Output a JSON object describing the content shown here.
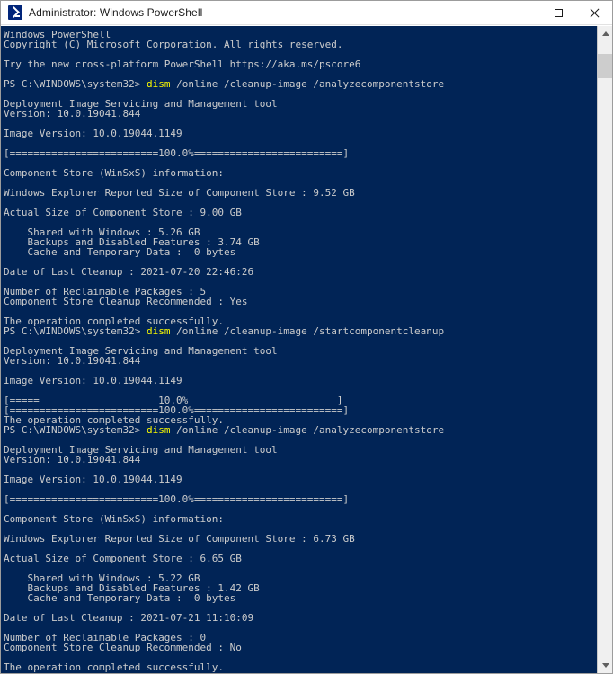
{
  "window": {
    "title": "Administrator: Windows PowerShell",
    "icon": "powershell-icon",
    "colors": {
      "console_background": "#012456",
      "console_text": "#cccccc",
      "command_highlight": "#f9f900",
      "titlebar_background": "#ffffff",
      "titlebar_text": "#1b1b1b",
      "scrollbar_track": "#f0f0f0",
      "scrollbar_thumb": "#cdcdcd"
    },
    "controls": [
      {
        "name": "minimize-button",
        "label": "─"
      },
      {
        "name": "maximize-button",
        "label": "□"
      },
      {
        "name": "close-button",
        "label": "✕"
      }
    ]
  },
  "scrollbar": {
    "up_arrow": "scroll-up-arrow",
    "down_arrow": "scroll-down-arrow",
    "thumb_top_percent": 2,
    "thumb_height_percent": 4
  },
  "console": {
    "prompt": "PS C:\\WINDOWS\\system32>",
    "commands": [
      "dism /online /cleanup-image /analyzecomponentstore",
      "dism /online /cleanup-image /startcomponentcleanup",
      "dism /online /cleanup-image /analyzecomponentstore"
    ],
    "lines": [
      {
        "text": "Windows PowerShell"
      },
      {
        "text": "Copyright (C) Microsoft Corporation. All rights reserved."
      },
      {
        "text": ""
      },
      {
        "text": "Try the new cross-platform PowerShell https://aka.ms/pscore6"
      },
      {
        "text": ""
      },
      {
        "prompt": "PS C:\\WINDOWS\\system32> ",
        "highlight": "dism",
        "rest": " /online /cleanup-image /analyzecomponentstore"
      },
      {
        "text": ""
      },
      {
        "text": "Deployment Image Servicing and Management tool"
      },
      {
        "text": "Version: 10.0.19041.844"
      },
      {
        "text": ""
      },
      {
        "text": "Image Version: 10.0.19044.1149"
      },
      {
        "text": ""
      },
      {
        "text": "[=========================100.0%=========================]"
      },
      {
        "text": ""
      },
      {
        "text": "Component Store (WinSxS) information:"
      },
      {
        "text": ""
      },
      {
        "text": "Windows Explorer Reported Size of Component Store : 9.52 GB"
      },
      {
        "text": ""
      },
      {
        "text": "Actual Size of Component Store : 9.00 GB"
      },
      {
        "text": ""
      },
      {
        "text": "    Shared with Windows : 5.26 GB"
      },
      {
        "text": "    Backups and Disabled Features : 3.74 GB"
      },
      {
        "text": "    Cache and Temporary Data :  0 bytes"
      },
      {
        "text": ""
      },
      {
        "text": "Date of Last Cleanup : 2021-07-20 22:46:26"
      },
      {
        "text": ""
      },
      {
        "text": "Number of Reclaimable Packages : 5"
      },
      {
        "text": "Component Store Cleanup Recommended : Yes"
      },
      {
        "text": ""
      },
      {
        "text": "The operation completed successfully."
      },
      {
        "prompt": "PS C:\\WINDOWS\\system32> ",
        "highlight": "dism",
        "rest": " /online /cleanup-image /startcomponentcleanup"
      },
      {
        "text": ""
      },
      {
        "text": "Deployment Image Servicing and Management tool"
      },
      {
        "text": "Version: 10.0.19041.844"
      },
      {
        "text": ""
      },
      {
        "text": "Image Version: 10.0.19044.1149"
      },
      {
        "text": ""
      },
      {
        "text": "[=====                    10.0%                         ]"
      },
      {
        "text": "[=========================100.0%=========================]"
      },
      {
        "text": "The operation completed successfully."
      },
      {
        "prompt": "PS C:\\WINDOWS\\system32> ",
        "highlight": "dism",
        "rest": " /online /cleanup-image /analyzecomponentstore"
      },
      {
        "text": ""
      },
      {
        "text": "Deployment Image Servicing and Management tool"
      },
      {
        "text": "Version: 10.0.19041.844"
      },
      {
        "text": ""
      },
      {
        "text": "Image Version: 10.0.19044.1149"
      },
      {
        "text": ""
      },
      {
        "text": "[=========================100.0%=========================]"
      },
      {
        "text": ""
      },
      {
        "text": "Component Store (WinSxS) information:"
      },
      {
        "text": ""
      },
      {
        "text": "Windows Explorer Reported Size of Component Store : 6.73 GB"
      },
      {
        "text": ""
      },
      {
        "text": "Actual Size of Component Store : 6.65 GB"
      },
      {
        "text": ""
      },
      {
        "text": "    Shared with Windows : 5.22 GB"
      },
      {
        "text": "    Backups and Disabled Features : 1.42 GB"
      },
      {
        "text": "    Cache and Temporary Data :  0 bytes"
      },
      {
        "text": ""
      },
      {
        "text": "Date of Last Cleanup : 2021-07-21 11:10:09"
      },
      {
        "text": ""
      },
      {
        "text": "Number of Reclaimable Packages : 0"
      },
      {
        "text": "Component Store Cleanup Recommended : No"
      },
      {
        "text": ""
      },
      {
        "text": "The operation completed successfully."
      }
    ]
  }
}
